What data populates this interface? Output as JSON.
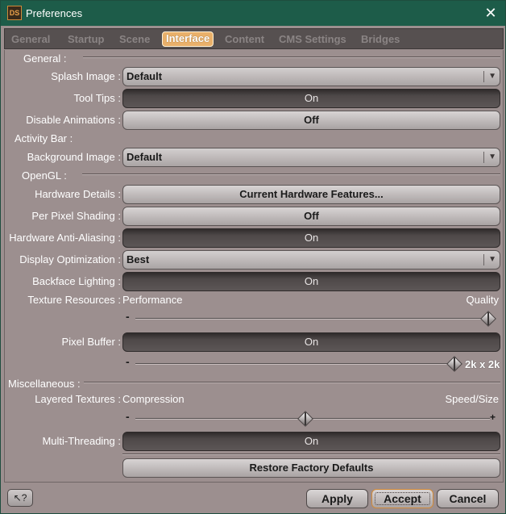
{
  "window": {
    "app_icon_text": "DS",
    "title": "Preferences",
    "close_glyph": "✕"
  },
  "tabs": [
    {
      "label": "General",
      "active": false
    },
    {
      "label": "Startup",
      "active": false
    },
    {
      "label": "Scene",
      "active": false
    },
    {
      "label": "Interface",
      "active": true
    },
    {
      "label": "Content",
      "active": false
    },
    {
      "label": "CMS Settings",
      "active": false
    },
    {
      "label": "Bridges",
      "active": false
    }
  ],
  "sections": {
    "general": "General :",
    "activity_bar": "Activity Bar :",
    "opengl": "OpenGL :",
    "miscellaneous": "Miscellaneous :"
  },
  "settings": {
    "splash_image": {
      "label": "Splash Image :",
      "value": "Default"
    },
    "tool_tips": {
      "label": "Tool Tips :",
      "value": "On"
    },
    "disable_animations": {
      "label": "Disable Animations :",
      "value": "Off"
    },
    "background_image": {
      "label": "Background Image :",
      "value": "Default"
    },
    "hardware_details": {
      "label": "Hardware Details :",
      "button": "Current Hardware Features..."
    },
    "per_pixel_shading": {
      "label": "Per Pixel Shading :",
      "value": "Off"
    },
    "hardware_anti_aliasing": {
      "label": "Hardware Anti-Aliasing :",
      "value": "On"
    },
    "display_optimization": {
      "label": "Display Optimization :",
      "value": "Best"
    },
    "backface_lighting": {
      "label": "Backface Lighting :",
      "value": "On"
    },
    "texture_resources": {
      "label": "Texture Resources :",
      "min_label": "Performance",
      "max_label": "Quality",
      "minus": "-",
      "level": 1.0
    },
    "pixel_buffer": {
      "label": "Pixel Buffer :",
      "value": "On",
      "minus": "-",
      "size": "2k x 2k",
      "level": 1.0
    },
    "layered_textures": {
      "label": "Layered Textures :",
      "min_label": "Compression",
      "max_label": "Speed/Size",
      "minus": "-",
      "plus": "+",
      "level": 0.5
    },
    "multi_threading": {
      "label": "Multi-Threading :",
      "value": "On"
    },
    "restore_defaults": "Restore Factory Defaults"
  },
  "dropdown_arrow": "▼",
  "footer": {
    "help": "?",
    "apply": "Apply",
    "accept": "Accept",
    "cancel": "Cancel"
  },
  "colors": {
    "titlebar": "#1d5c49",
    "panel": "#9c8f8f",
    "active_tab": "#e9b06a",
    "toggle_on": "#4e4848"
  }
}
